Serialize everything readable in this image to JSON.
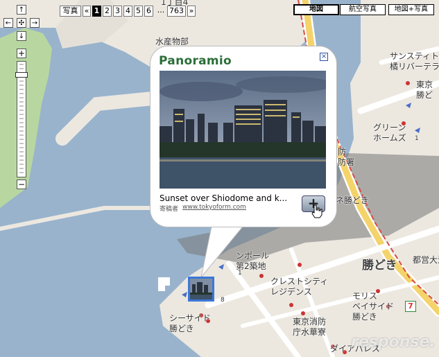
{
  "photo_bar": {
    "label": "写真",
    "prev": "«",
    "pages": [
      "1",
      "2",
      "3",
      "4",
      "5",
      "6"
    ],
    "ellipsis": "...",
    "last_page": "763",
    "next": "»",
    "current_page": "1"
  },
  "map_types": {
    "map": "地図",
    "satellite": "航空写真",
    "hybrid": "地図+写真",
    "selected": "地図"
  },
  "nav": {
    "up": "↑",
    "down": "↓",
    "left": "←",
    "right": "→",
    "center": "✣",
    "zoom_in": "+",
    "zoom_out": "−"
  },
  "zoom": {
    "level_fraction": 0.9
  },
  "popup": {
    "logo": "Panoramio",
    "close": "×",
    "caption": "Sunset over Shiodome and k...",
    "author_label": "寄稿者",
    "author": "www.tokyoform.com",
    "zoom_button": "+"
  },
  "labels": {
    "suisan": "水産物部",
    "top_cut": "1丁目4",
    "suntight": "サンスティト\n橘リバーテラ",
    "tokyo_right": "東京\n勝ど",
    "green_homes": "グリーン\nホームズ",
    "green_num": "1",
    "rescue": "防\n防署",
    "kachidoki_bridge": "ネ勝どき",
    "daini": "ンポール\n第2築地",
    "kachidoki": "勝どき",
    "toei": "都営大江",
    "crest": "クレストシティ\nレジデンス",
    "morris": "モリス\nベイサイド\n勝どき",
    "tokyo_fire": "東京消防\n庁水華寮",
    "seaside": "シーサイド\n勝どき",
    "diapalace": "ダイアパレス",
    "num1": "1",
    "num8": "8",
    "seven": "7"
  },
  "watermark": "response."
}
